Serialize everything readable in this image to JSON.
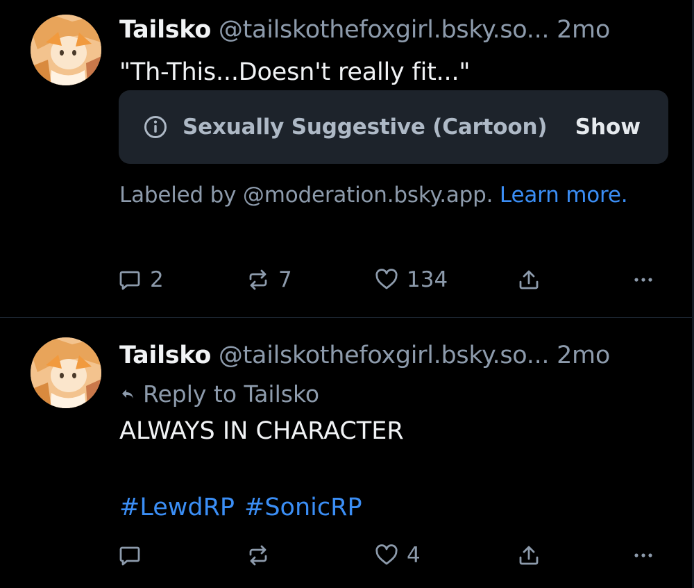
{
  "posts": [
    {
      "author_name": "Tailsko",
      "author_handle": "@tailskothefoxgirl.bsky.so...",
      "timestamp": "2mo",
      "text": "\"Th-This...Doesn't really fit...\"",
      "content_warning": {
        "icon": "info-circle-icon",
        "label": "Sexually Suggestive (Cartoon)",
        "action": "Show"
      },
      "labeled_by": "Labeled by @moderation.bsky.app.",
      "learn_more": "Learn more.",
      "reply_count": "2",
      "repost_count": "7",
      "like_count": "134"
    },
    {
      "author_name": "Tailsko",
      "author_handle": "@tailskothefoxgirl.bsky.so...",
      "timestamp": "2mo",
      "reply_to": "Reply to Tailsko",
      "text": "ALWAYS IN CHARACTER",
      "hashtags": [
        "#LewdRP",
        "#SonicRP"
      ],
      "reply_count": "",
      "repost_count": "",
      "like_count": "4"
    }
  ],
  "colors": {
    "background": "#000000",
    "text_primary": "#f1f3f5",
    "text_secondary": "#8d9bac",
    "link": "#3b8ef5",
    "warning_box": "#1d232b"
  }
}
